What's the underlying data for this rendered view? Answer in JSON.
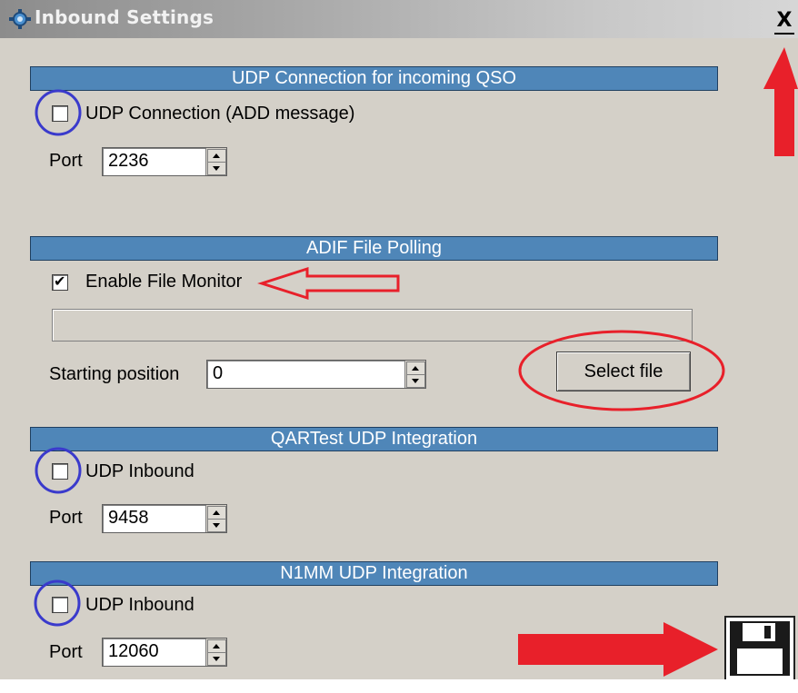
{
  "window": {
    "title": "Inbound Settings",
    "close_label": "X",
    "icon": "settings-gear-icon"
  },
  "udp_incoming": {
    "header": "UDP Connection for incoming QSO",
    "checkbox_label": "UDP Connection (ADD message)",
    "checked": false,
    "port_label": "Port",
    "port_value": "2236"
  },
  "adif": {
    "header": "ADIF File Polling",
    "checkbox_label": "Enable File Monitor",
    "checked": true,
    "file_path": "",
    "start_label": "Starting position",
    "start_value": "0",
    "select_button": "Select file"
  },
  "qartest": {
    "header": "QARTest UDP Integration",
    "checkbox_label": "UDP Inbound",
    "checked": false,
    "port_label": "Port",
    "port_value": "9458"
  },
  "n1mm": {
    "header": "N1MM UDP Integration",
    "checkbox_label": "UDP Inbound",
    "checked": false,
    "port_label": "Port",
    "port_value": "12060"
  },
  "save": {
    "icon": "floppy-disk-save-icon"
  },
  "colors": {
    "header_bg": "#4f86b8",
    "annotation_red": "#e8202a",
    "annotation_blue": "#3a3acc"
  }
}
